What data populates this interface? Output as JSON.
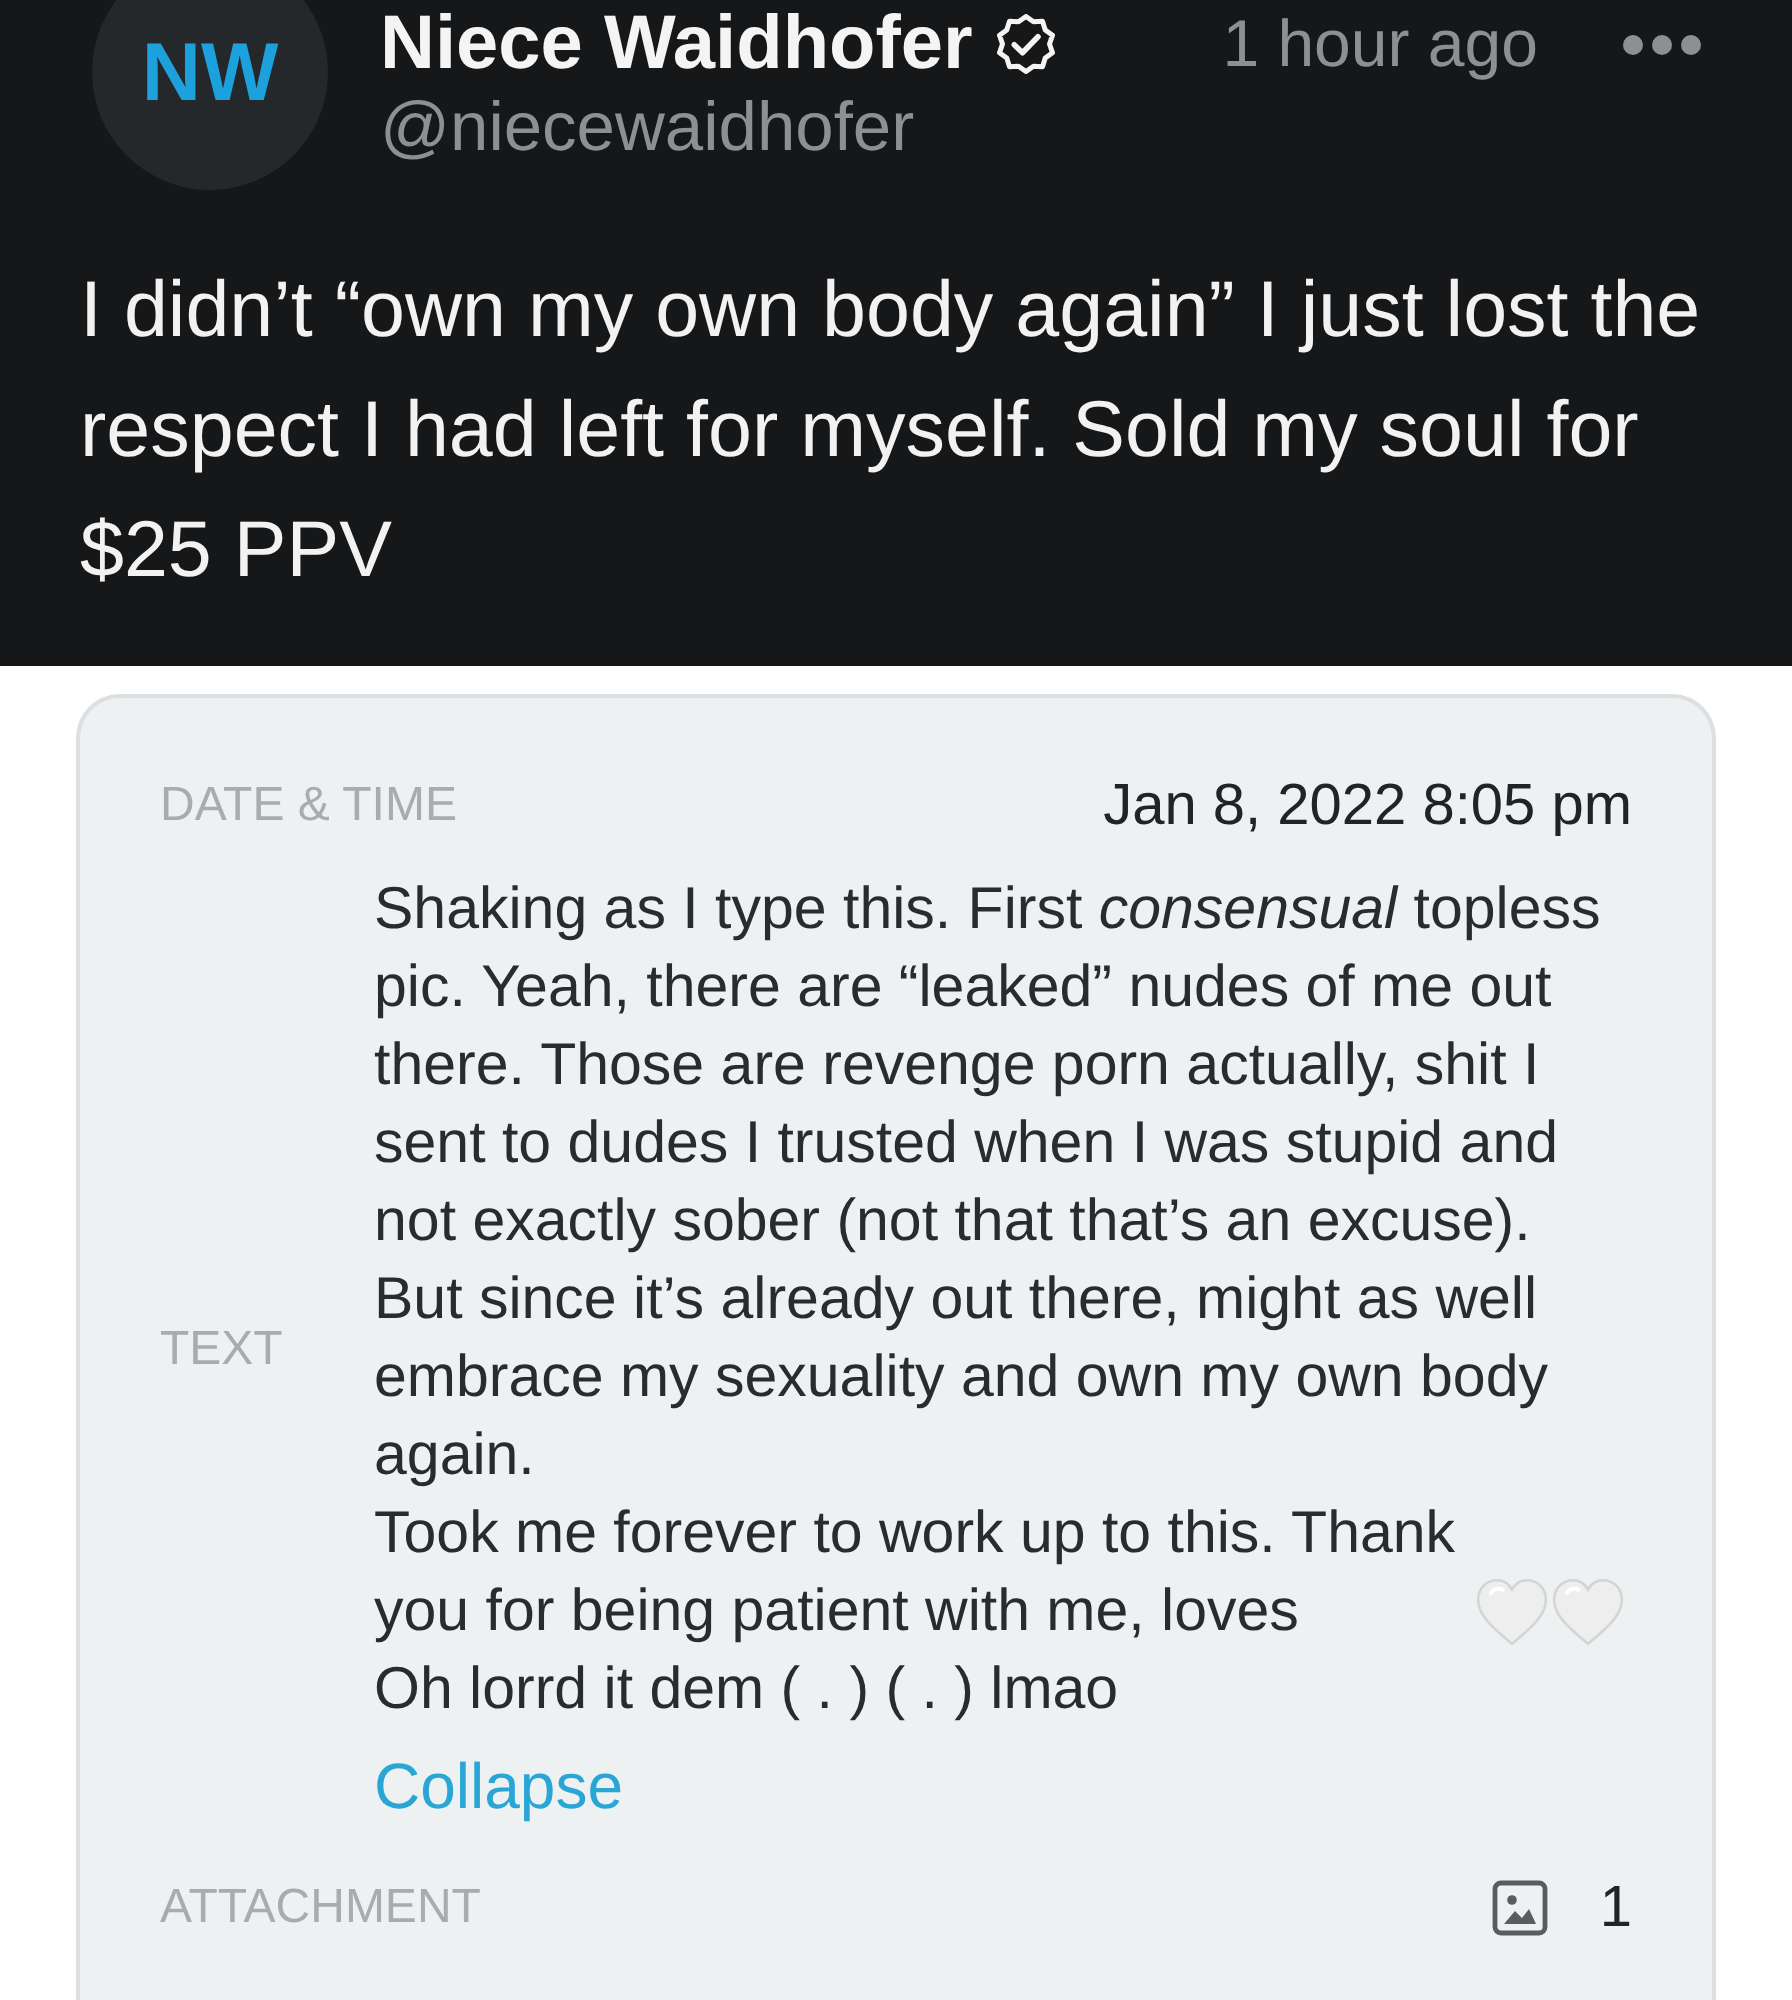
{
  "post": {
    "avatar_initials": "NW",
    "name": "Niece Waidhofer",
    "verified": true,
    "handle": "@niecewaidhofer",
    "time": "1 hour ago",
    "text": "I didn’t “own my own body again” I just lost the respect I had left for myself. Sold my soul for $25 PPV"
  },
  "details": {
    "rows": [
      {
        "kind": "datetime",
        "label": "DATE & TIME",
        "value": "Jan 8, 2022 8:05 pm"
      },
      {
        "kind": "message",
        "label": "TEXT",
        "paragraphs": [
          {
            "text": "Shaking as I type this. First *consensual* topless pic. Yeah, there are “leaked” nudes of me out there. Those are revenge porn actually, shit I sent to dudes I trusted when I was stupid and not exactly sober (not that that’s an excuse). But since it’s already out there, might as well embrace my sexuality and own my own body again."
          },
          {
            "text": "Took me forever to work up to this. Thank you for being patient with me, loves",
            "emoji": [
              {
                "kind": "heart"
              },
              {
                "kind": "heart"
              }
            ]
          },
          {
            "text": "Oh lorrd it dem ( . ) ( . ) lmao"
          }
        ],
        "link": "Collapse"
      },
      {
        "kind": "attachment",
        "label": "ATTACHMENT",
        "count": "1"
      }
    ]
  }
}
